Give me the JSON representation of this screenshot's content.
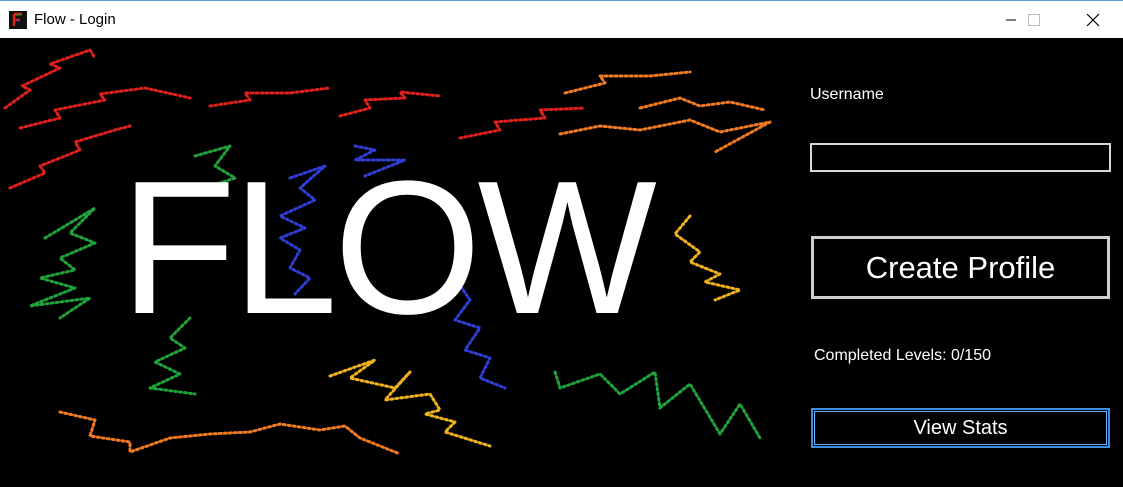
{
  "window": {
    "title": "Flow - Login",
    "icon": "flow-app-icon",
    "controls": [
      "minimize",
      "maximize",
      "close"
    ]
  },
  "art": {
    "logo_text": "FLOW",
    "stroke_colors": [
      "#e0201c",
      "#ef7a22",
      "#1fa33a",
      "#2f3fd6",
      "#f0b21c"
    ]
  },
  "form": {
    "username_label": "Username",
    "username_value": "",
    "create_button": "Create Profile",
    "completed_levels": "Completed Levels: 0/150",
    "stats_button": "View Stats"
  },
  "colors": {
    "background": "#000000",
    "focus_border": "#3a8ee6"
  }
}
